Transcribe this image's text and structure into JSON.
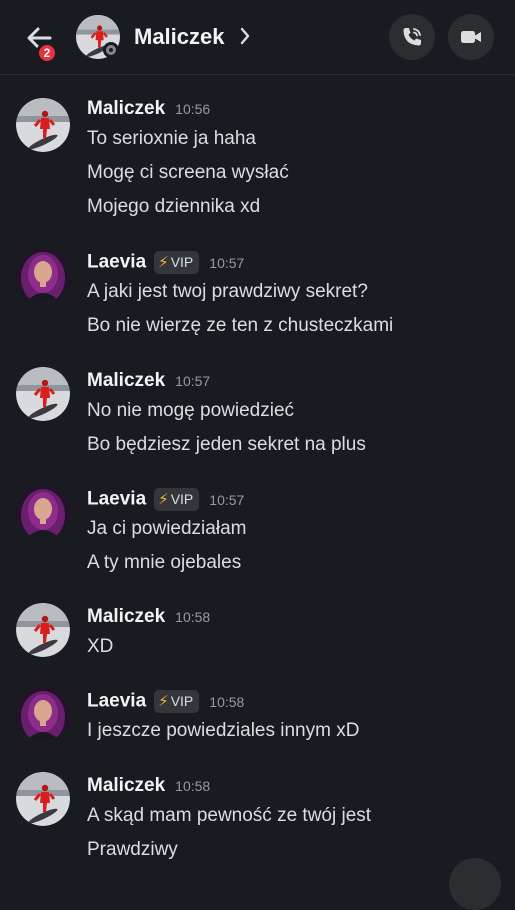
{
  "header": {
    "back_badge": "2",
    "title": "Maliczek",
    "colors": {
      "background": "#1a1b20",
      "badge": "#e5323d"
    },
    "icons": [
      "back-arrow-icon",
      "chevron-right-icon",
      "voice-call-icon",
      "video-camera-icon",
      "offline-status-icon"
    ]
  },
  "messages": [
    {
      "author": "Maliczek",
      "time": "10:56",
      "lines": [
        "To serioxnie ja haha",
        "Mogę ci screena wysłać",
        "Mojego dziennika xd"
      ]
    },
    {
      "author": "Laevia",
      "badge": "VIP",
      "time": "10:57",
      "lines": [
        "A jaki jest twoj prawdziwy sekret?",
        "Bo nie wierzę ze ten z chusteczkami"
      ]
    },
    {
      "author": "Maliczek",
      "time": "10:57",
      "lines": [
        "No nie mogę powiedzieć",
        "Bo będziesz jeden sekret na plus"
      ]
    },
    {
      "author": "Laevia",
      "badge": "VIP",
      "time": "10:57",
      "lines": [
        "Ja ci powiedziałam",
        "A ty mnie ojebales"
      ]
    },
    {
      "author": "Maliczek",
      "time": "10:58",
      "lines": [
        "XD"
      ]
    },
    {
      "author": "Laevia",
      "badge": "VIP",
      "time": "10:58",
      "lines": [
        "I jeszcze powiedziales innym xD"
      ]
    },
    {
      "author": "Maliczek",
      "time": "10:58",
      "lines": [
        "A skąd mam pewność ze twój jest",
        "Prawdziwy"
      ]
    }
  ]
}
